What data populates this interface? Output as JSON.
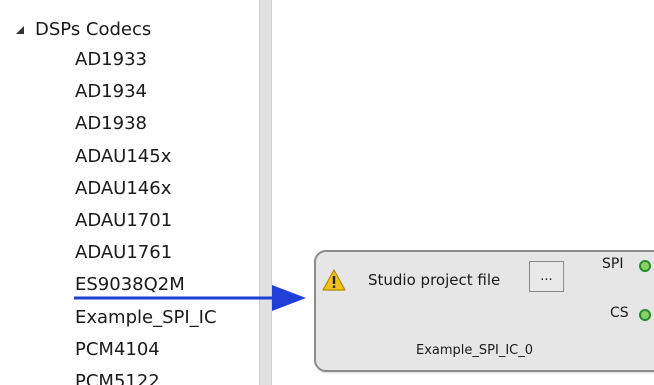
{
  "tree": {
    "header": "DSPs Codecs",
    "items": [
      "AD1933",
      "AD1934",
      "AD1938",
      "ADAU145x",
      "ADAU146x",
      "ADAU1701",
      "ADAU1761",
      "ES9038Q2M",
      "Example_SPI_IC",
      "PCM4104",
      "PCM5122"
    ]
  },
  "block": {
    "label": "Studio project file",
    "browse_label": "...",
    "pin_spi": "SPI",
    "pin_cs": "CS",
    "instance_name": "Example_SPI_IC_0"
  },
  "colors": {
    "arrow": "#1f3fd6",
    "pin_fill": "#8ad36a",
    "pin_stroke": "#2c8a2c",
    "warning": "#f2c21a"
  },
  "icons": {
    "tree_toggle": "expanded-triangle-icon",
    "warning": "warning-icon"
  }
}
